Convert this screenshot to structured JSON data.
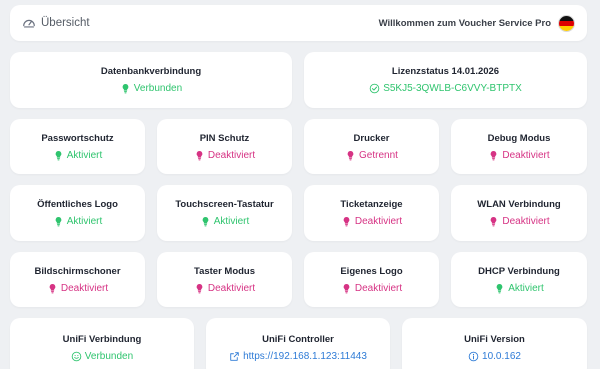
{
  "header": {
    "overview_label": "Übersicht",
    "welcome_text": "Willkommen zum Voucher Service Pro",
    "flag_icon": "germany-flag-icon"
  },
  "colors": {
    "active": "#2fc46e",
    "inactive": "#d63384",
    "link": "#2e7bd6"
  },
  "tiles": [
    {
      "title": "Datenbankverbindung",
      "status": "Verbunden",
      "state": "active",
      "icon": "bulb-icon"
    },
    {
      "title": "Lizenzstatus 14.01.2026",
      "status": "S5KJ5-3QWLB-C6VVY-BTPTX",
      "state": "active",
      "icon": "check-circle-icon"
    },
    {
      "title": "Passwortschutz",
      "status": "Aktiviert",
      "state": "active",
      "icon": "bulb-icon"
    },
    {
      "title": "PIN Schutz",
      "status": "Deaktiviert",
      "state": "inactive",
      "icon": "bulb-icon"
    },
    {
      "title": "Drucker",
      "status": "Getrennt",
      "state": "inactive",
      "icon": "bulb-icon"
    },
    {
      "title": "Debug Modus",
      "status": "Deaktiviert",
      "state": "inactive",
      "icon": "bulb-icon"
    },
    {
      "title": "Öffentliches Logo",
      "status": "Aktiviert",
      "state": "active",
      "icon": "bulb-icon"
    },
    {
      "title": "Touchscreen-Tastatur",
      "status": "Aktiviert",
      "state": "active",
      "icon": "bulb-icon"
    },
    {
      "title": "Ticketanzeige",
      "status": "Deaktiviert",
      "state": "inactive",
      "icon": "bulb-icon"
    },
    {
      "title": "WLAN Verbindung",
      "status": "Deaktiviert",
      "state": "inactive",
      "icon": "bulb-icon"
    },
    {
      "title": "Bildschirmschoner",
      "status": "Deaktiviert",
      "state": "inactive",
      "icon": "bulb-icon"
    },
    {
      "title": "Taster Modus",
      "status": "Deaktiviert",
      "state": "inactive",
      "icon": "bulb-icon"
    },
    {
      "title": "Eigenes Logo",
      "status": "Deaktiviert",
      "state": "inactive",
      "icon": "bulb-icon"
    },
    {
      "title": "DHCP Verbindung",
      "status": "Aktiviert",
      "state": "active",
      "icon": "bulb-icon"
    },
    {
      "title": "UniFi Verbindung",
      "status": "Verbunden",
      "state": "active",
      "icon": "smiley-icon"
    },
    {
      "title": "UniFi Controller",
      "status": "https://192.168.1.123:11443",
      "state": "link",
      "icon": "external-link-icon"
    },
    {
      "title": "UniFi Version",
      "status": "10.0.162",
      "state": "link",
      "icon": "info-icon"
    }
  ]
}
